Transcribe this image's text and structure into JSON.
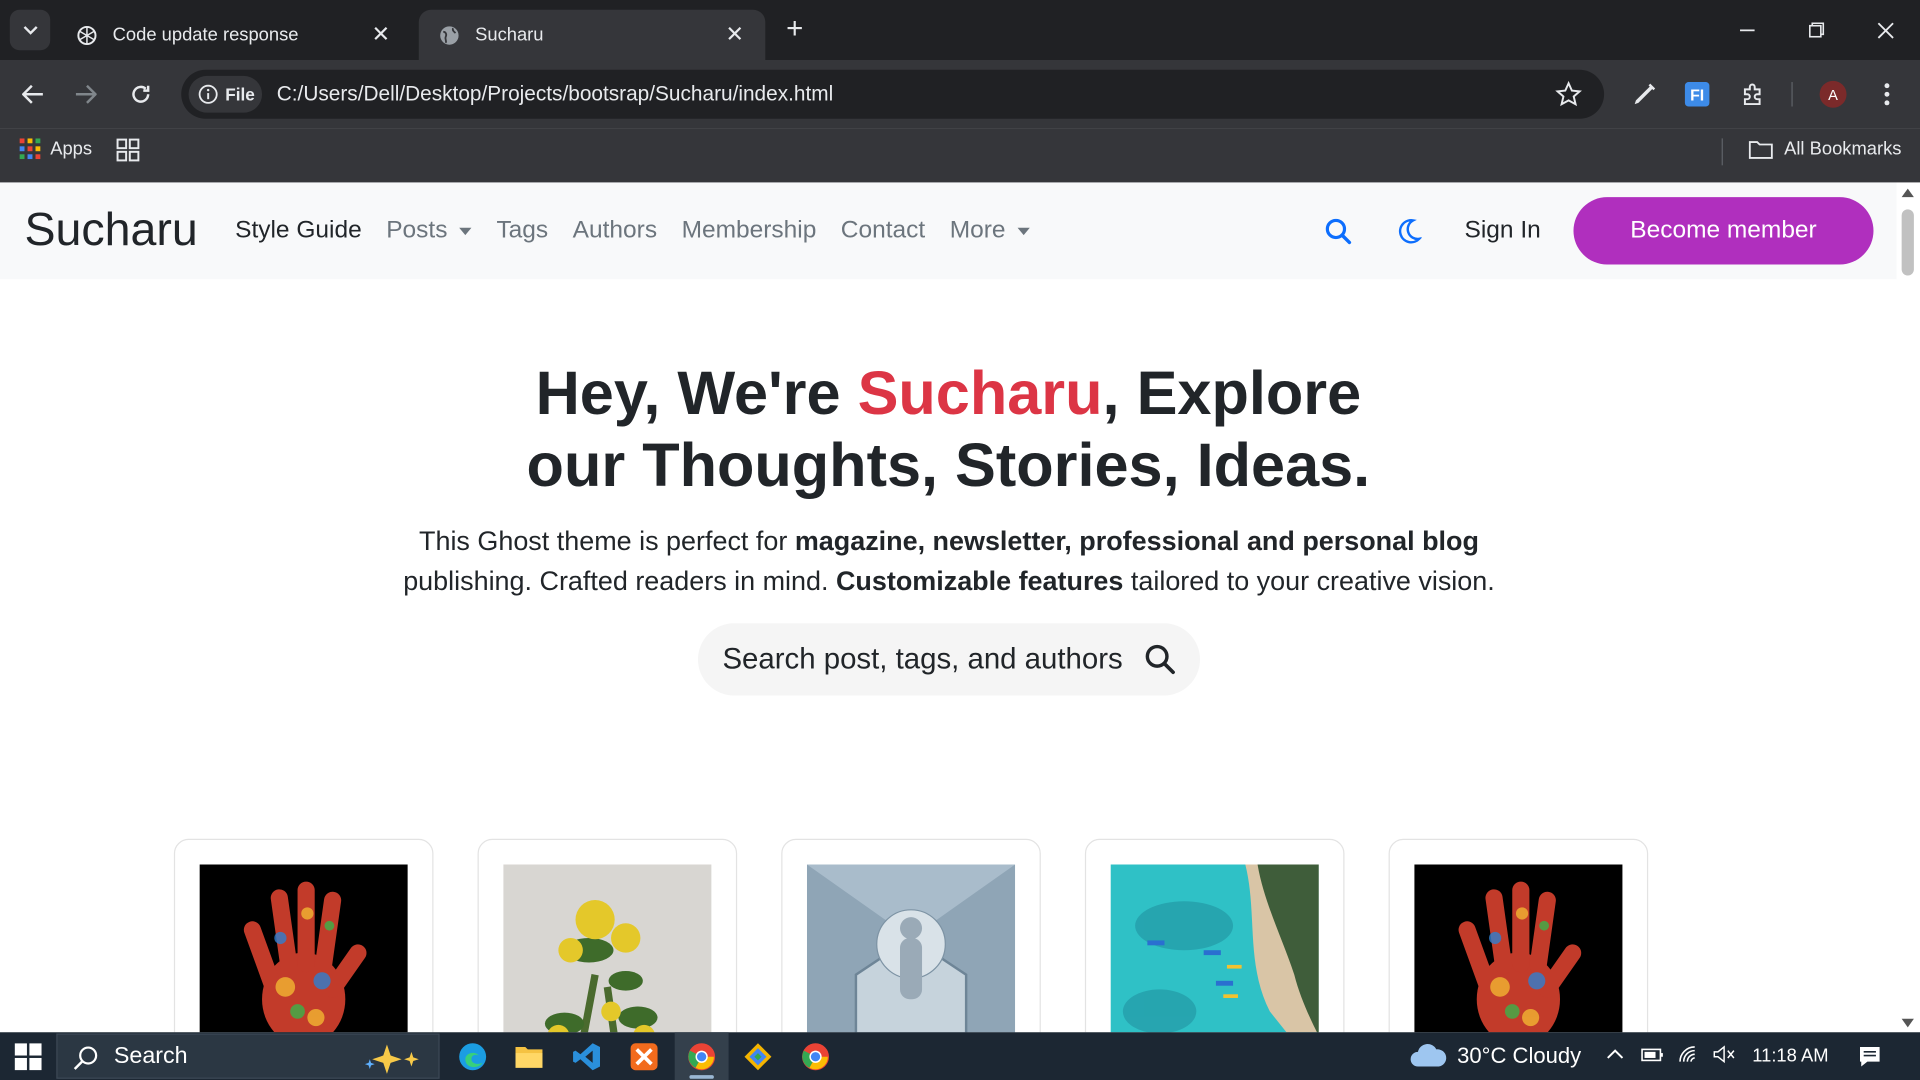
{
  "browser": {
    "tabs": [
      {
        "title": "Code update response",
        "active": false
      },
      {
        "title": "Sucharu",
        "active": true
      }
    ],
    "address": {
      "scheme_chip": "File",
      "url": "C:/Users/Dell/Desktop/Projects/bootsrap/Sucharu/index.html"
    },
    "profile_initial": "A",
    "extension_badge": "FI",
    "bookmarks": {
      "apps_label": "Apps",
      "all_bookmarks_label": "All Bookmarks"
    }
  },
  "site": {
    "brand": "Sucharu",
    "nav": [
      {
        "label": "Style Guide",
        "active": true,
        "dropdown": false
      },
      {
        "label": "Posts",
        "active": false,
        "dropdown": true
      },
      {
        "label": "Tags",
        "active": false,
        "dropdown": false
      },
      {
        "label": "Authors",
        "active": false,
        "dropdown": false
      },
      {
        "label": "Membership",
        "active": false,
        "dropdown": false
      },
      {
        "label": "Contact",
        "active": false,
        "dropdown": false
      },
      {
        "label": "More",
        "active": false,
        "dropdown": true
      }
    ],
    "sign_in": "Sign In",
    "cta": "Become member",
    "accent_color": "#b02fbe",
    "hero": {
      "title_part1": "Hey, We're ",
      "title_highlight": "Sucharu",
      "title_part2": ", Explore",
      "title_line2": "our Thoughts, Stories, Ideas.",
      "highlight_color": "#dc3545",
      "sub_part1": "This Ghost theme is perfect for ",
      "sub_bold1": "magazine, newsletter, professional and personal blog",
      "sub_part2": " publishing. Crafted readers in mind. ",
      "sub_bold2": "Customizable features",
      "sub_part3": " tailored to your creative vision.",
      "search_placeholder": "Search post, tags, and authors"
    },
    "cards": [
      {
        "image": "painted-hand-icon"
      },
      {
        "image": "yellow-roses-icon"
      },
      {
        "image": "statue-sphere-icon"
      },
      {
        "image": "beach-boats-icon"
      },
      {
        "image": "painted-hand-icon"
      }
    ]
  },
  "taskbar": {
    "search_label": "Search",
    "weather": "30°C  Cloudy",
    "time": "11:18 AM"
  }
}
